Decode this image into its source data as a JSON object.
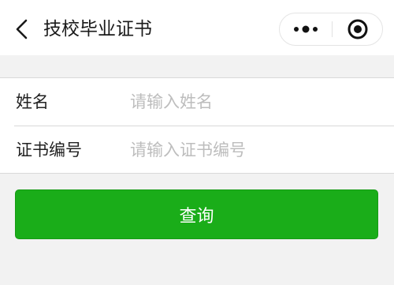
{
  "nav": {
    "title": "技校毕业证书"
  },
  "form": {
    "name_label": "姓名",
    "name_placeholder": "请输入姓名",
    "name_value": "",
    "cert_label": "证书编号",
    "cert_placeholder": "请输入证书编号",
    "cert_value": ""
  },
  "actions": {
    "query_label": "查询"
  },
  "colors": {
    "accent": "#1aad19",
    "background": "#f2f2f2"
  }
}
